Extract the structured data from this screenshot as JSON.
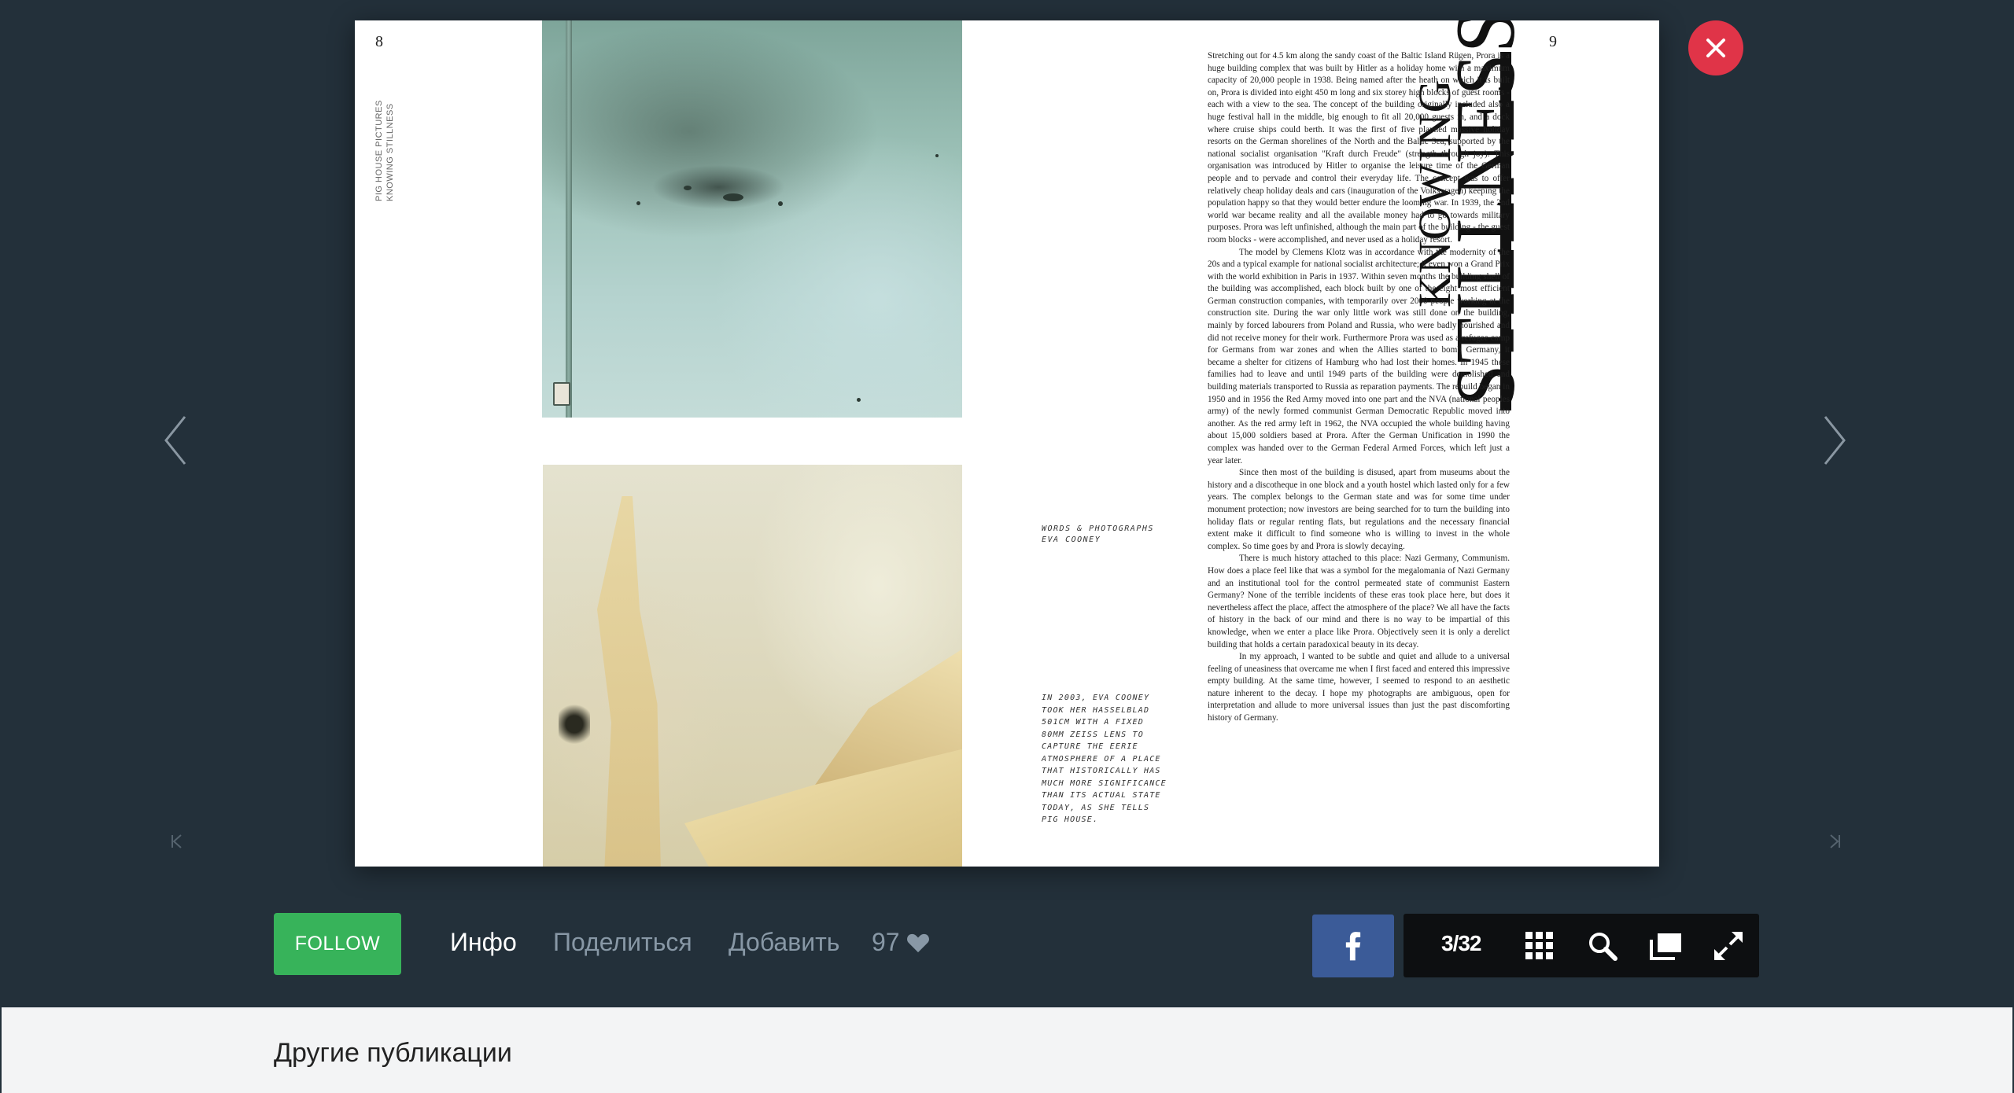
{
  "spread": {
    "left_page_number": "8",
    "right_page_number": "9",
    "running_head": [
      "PIG HOUSE PICTURES",
      "KNOWING STILLNESS"
    ],
    "title_line1": "KNOWING",
    "title_line2": "STILLNESS",
    "credits": "WORDS & PHOTOGRAPHS\nEVA COONEY",
    "intro": "IN 2003, EVA COONEY TOOK HER HASSELBLAD 501CM WITH A FIXED 80MM ZEISS LENS TO CAPTURE THE EERIE ATMOSPHERE OF A PLACE THAT HISTORICALLY HAS MUCH MORE SIGNIFICANCE THAN ITS ACTUAL STATE TODAY, AS SHE TELLS PIG HOUSE.",
    "body_paragraphs": [
      "Stretching out for 4.5 km along the sandy coast of the Baltic Island Rügen, Prora is a huge building complex that was built by Hitler as a holiday home with a maximum capacity of 20,000 people in 1938. Being named after the heath on which it is built on, Prora is divided into eight 450 m long and six storey high blocks of guest rooms - each with a view to the sea. The concept of the building originally included also a huge festival hall in the middle, big enough to fit all 20,000 guests in, and a dock where cruise ships could berth. It was the first of five planned massive holiday resorts on the German shorelines of the North and the Baltic Sea, supported by the national socialist organisation \"Kraft durch Freude\" (strength through joy). This organisation was introduced by Hitler to organise the leisure time of the German people and to pervade and control their everyday life. The concept was to offer relatively cheap holiday deals and cars (inauguration of the Volkswagen) keeping the population happy so that they would better endure the looming war. In 1939, the 2nd world war became reality and all the available money had to go towards military purposes. Prora was left unfinished, although the main part of the building - the guest room blocks - were accomplished, and never used as a holiday resort.",
      "The model by Clemens Klotz was in accordance with the modernity of the 20s and a typical example for national socialist architecture; it even won a Grand Prix with the world exhibition in Paris in 1937. Within seven months the building shell of the building was accomplished, each block built by one of the eight most efficient German construction companies, with temporarily over 2000 people working at the construction site. During the war only little work was still done on the building, mainly by forced labourers from Poland and Russia, who were badly nourished and did not receive money for their work. Furthermore Prora was used as a refugee camp for Germans from war zones and when the Allies started to bomb Germany, it became a shelter for citizens of Hamburg who had lost their homes. In 1945 these families had to leave and until 1949 parts of the building were demolished and building materials transported to Russia as reparation payments. The rebuild began in 1950 and in 1956 the Red Army moved into one part and the NVA (national peoples army) of the newly formed communist German Democratic Republic moved into another. As the red army left in 1962, the NVA occupied the whole building having about 15,000 soldiers based at Prora.  After the German Unification in 1990 the complex was handed over to the German Federal Armed Forces, which left just a year later.",
      "Since then most of the building is disused, apart from museums about the history and a discotheque in one block and a youth hostel which lasted only for a few years. The complex belongs to the German state and was for some time under monument protection; now investors are being searched for to turn the building into holiday flats or regular renting flats, but regulations and the necessary financial extent make it difficult to find someone who is willing to invest in the whole complex. So time goes by and Prora is slowly decaying.",
      "There is much history attached to this place: Nazi Germany, Communism. How does a place feel like that was a symbol for the megalomania of Nazi Germany and an institutional tool for the control permeated state of communist Eastern Germany? None of the terrible incidents of these eras took place here, but does it nevertheless affect the place, affect the atmosphere of the place? We all have the facts of history in the back of our mind and there is no way to be impartial of this knowledge, when we enter a place like Prora. Objectively seen it is only a derelict building that holds a certain paradoxical beauty in its decay.",
      "In my approach, I wanted to be subtle and quiet and allude to a universal feeling of uneasiness that overcame me when I first faced and entered this impressive empty building. At the same time, however, I seemed to respond to an aesthetic nature inherent to the decay. I hope my photographs are ambiguous, open for interpretation and allude to more universal issues than just the past discomforting history of Germany."
    ]
  },
  "toolbar": {
    "follow_label": "FOLLOW",
    "tab_info": "Инфо",
    "tab_share": "Поделиться",
    "tab_add": "Добавить",
    "likes_count": "97",
    "page_counter": "3/32"
  },
  "footer": {
    "other_publications": "Другие публикации"
  },
  "colors": {
    "background": "#23303a",
    "close": "#e03448",
    "follow": "#37b35a",
    "facebook": "#3b5b98",
    "tools_bg": "#0d0f11"
  },
  "icons": [
    "close-icon",
    "chevron-left-icon",
    "chevron-right-icon",
    "first-page-icon",
    "last-page-icon",
    "heart-icon",
    "facebook-icon",
    "grid-icon",
    "search-icon",
    "pages-icon",
    "fullscreen-icon"
  ]
}
